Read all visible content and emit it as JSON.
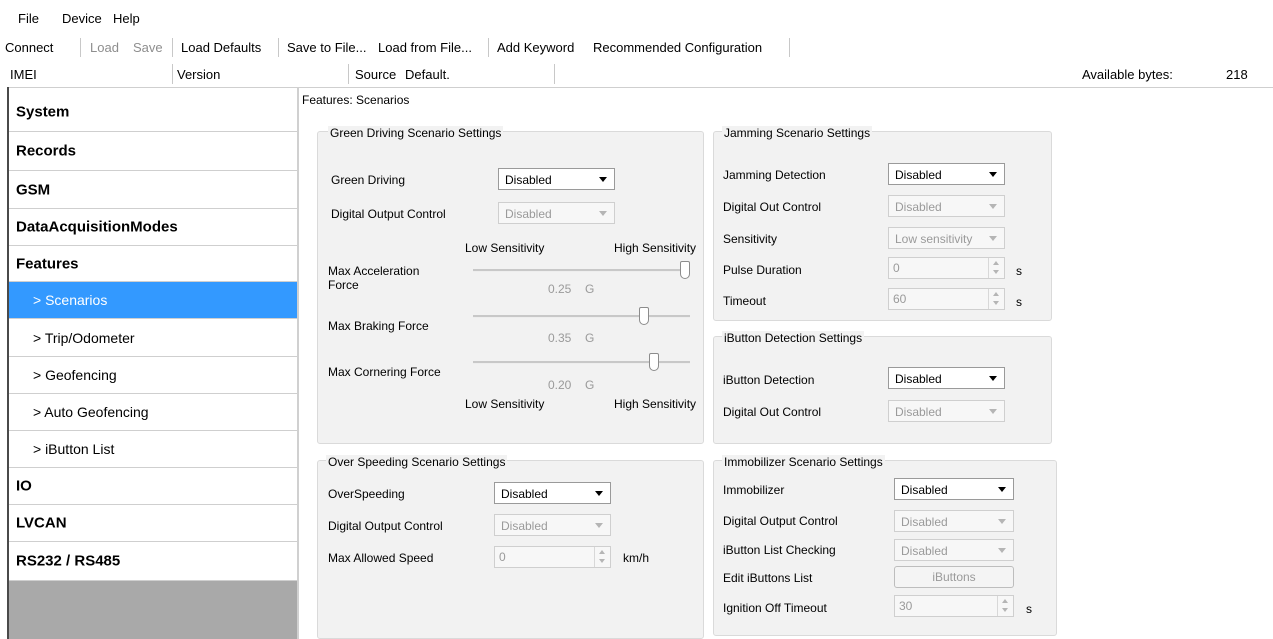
{
  "menu": [
    "File",
    "Device",
    "Help"
  ],
  "toolbar": {
    "connect": "Connect",
    "load": "Load",
    "save": "Save",
    "load_defaults": "Load Defaults",
    "save_to_file": "Save to File...",
    "load_from_file": "Load from File...",
    "add_keyword": "Add Keyword",
    "recommended": "Recommended Configuration"
  },
  "infobar": {
    "imei_label": "IMEI",
    "version_label": "Version",
    "source_label": "Source",
    "source_value": "Default.",
    "available_label": "Available bytes:",
    "available_value": "218"
  },
  "sidebar": {
    "items": [
      {
        "label": "System",
        "level": "main",
        "active": false
      },
      {
        "label": "Records",
        "level": "main",
        "active": false
      },
      {
        "label": "GSM",
        "level": "main",
        "active": false
      },
      {
        "label": "DataAcquisitionModes",
        "level": "main",
        "active": false
      },
      {
        "label": "Features",
        "level": "main",
        "active": false
      },
      {
        "label": "> Scenarios",
        "level": "sub",
        "active": true
      },
      {
        "label": "> Trip/Odometer",
        "level": "sub",
        "active": false
      },
      {
        "label": "> Geofencing",
        "level": "sub",
        "active": false
      },
      {
        "label": "> Auto Geofencing",
        "level": "sub",
        "active": false
      },
      {
        "label": "> iButton List",
        "level": "sub",
        "active": false
      },
      {
        "label": "IO",
        "level": "main",
        "active": false
      },
      {
        "label": "LVCAN",
        "level": "main",
        "active": false
      },
      {
        "label": "RS232 / RS485",
        "level": "main",
        "active": false
      }
    ]
  },
  "breadcrumb": "Features: Scenarios",
  "green_driving": {
    "title": "Green Driving Scenario Settings",
    "green_driving_label": "Green Driving",
    "green_driving_value": "Disabled",
    "dout_label": "Digital Output Control",
    "dout_value": "Disabled",
    "low_sens": "Low Sensitivity",
    "high_sens": "High Sensitivity",
    "accel_label": "Max Acceleration Force",
    "accel_value": "0.25",
    "brake_label": "Max Braking Force",
    "brake_value": "0.35",
    "corner_label": "Max Cornering Force",
    "corner_value": "0.20",
    "unit": "G",
    "accel_level": 1.0,
    "brake_level": 0.8,
    "corner_level": 0.85
  },
  "over_speeding": {
    "title": "Over Speeding Scenario Settings",
    "overspeed_label": "OverSpeeding",
    "overspeed_value": "Disabled",
    "dout_label": "Digital Output Control",
    "dout_value": "Disabled",
    "max_speed_label": "Max Allowed Speed",
    "max_speed_value": "0",
    "unit": "km/h"
  },
  "jamming": {
    "title": "Jamming Scenario Settings",
    "detection_label": "Jamming Detection",
    "detection_value": "Disabled",
    "dout_label": "Digital Out Control",
    "dout_value": "Disabled",
    "sensitivity_label": "Sensitivity",
    "sensitivity_value": "Low sensitivity",
    "pulse_label": "Pulse Duration",
    "pulse_value": "0",
    "timeout_label": "Timeout",
    "timeout_value": "60",
    "unit": "s"
  },
  "ibutton": {
    "title": "iButton Detection Settings",
    "detection_label": "iButton Detection",
    "detection_value": "Disabled",
    "dout_label": "Digital Out Control",
    "dout_value": "Disabled"
  },
  "immobilizer": {
    "title": "Immobilizer Scenario Settings",
    "immobilizer_label": "Immobilizer",
    "immobilizer_value": "Disabled",
    "dout_label": "Digital Output Control",
    "dout_value": "Disabled",
    "list_check_label": "iButton List Checking",
    "list_check_value": "Disabled",
    "edit_list_label": "Edit iButtons List",
    "ibuttons_button": "iButtons",
    "ign_off_label": "Ignition Off Timeout",
    "ign_off_value": "30",
    "unit": "s"
  }
}
